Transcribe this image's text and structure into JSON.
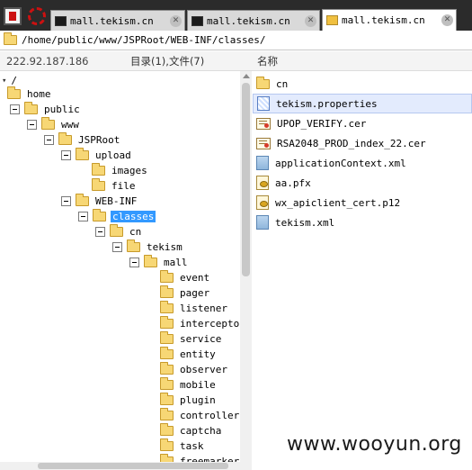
{
  "tabs": [
    {
      "label": "mall.tekism.cn",
      "icon": "terminal-icon",
      "active": false
    },
    {
      "label": "mall.tekism.cn",
      "icon": "terminal-icon",
      "active": false
    },
    {
      "label": "mall.tekism.cn",
      "icon": "folder-icon",
      "active": true
    }
  ],
  "path": "/home/public/www/JSPRoot/WEB-INF/classes/",
  "info": {
    "ip": "222.92.187.186",
    "summary": "目录(1),文件(7)",
    "name_column": "名称"
  },
  "tree": {
    "root": "/",
    "items": [
      {
        "label": "home"
      },
      {
        "label": "public"
      },
      {
        "label": "www"
      },
      {
        "label": "JSPRoot"
      },
      {
        "label": "upload"
      },
      {
        "label": "images"
      },
      {
        "label": "file"
      },
      {
        "label": "WEB-INF"
      },
      {
        "label": "classes",
        "selected": true
      },
      {
        "label": "cn"
      },
      {
        "label": "tekism"
      },
      {
        "label": "mall"
      },
      {
        "label": "event"
      },
      {
        "label": "pager"
      },
      {
        "label": "listener"
      },
      {
        "label": "interceptor"
      },
      {
        "label": "service"
      },
      {
        "label": "entity"
      },
      {
        "label": "observer"
      },
      {
        "label": "mobile"
      },
      {
        "label": "plugin"
      },
      {
        "label": "controller"
      },
      {
        "label": "captcha"
      },
      {
        "label": "task"
      },
      {
        "label": "freemarker"
      }
    ]
  },
  "files": [
    {
      "label": "cn",
      "icon": "folder-icon"
    },
    {
      "label": "tekism.properties",
      "icon": "properties-file-icon",
      "selected": true
    },
    {
      "label": "UPOP_VERIFY.cer",
      "icon": "certificate-icon"
    },
    {
      "label": "RSA2048_PROD_index_22.cer",
      "icon": "certificate-icon"
    },
    {
      "label": "applicationContext.xml",
      "icon": "xml-file-icon"
    },
    {
      "label": "aa.pfx",
      "icon": "pfx-file-icon"
    },
    {
      "label": "wx_apiclient_cert.p12",
      "icon": "pfx-file-icon"
    },
    {
      "label": "tekism.xml",
      "icon": "xml-file-icon"
    }
  ],
  "watermark": "www.wooyun.org",
  "colors": {
    "tabbar": "#2b2b2b",
    "selection": "#3399ff",
    "file_selection": "#e3ebfd"
  }
}
